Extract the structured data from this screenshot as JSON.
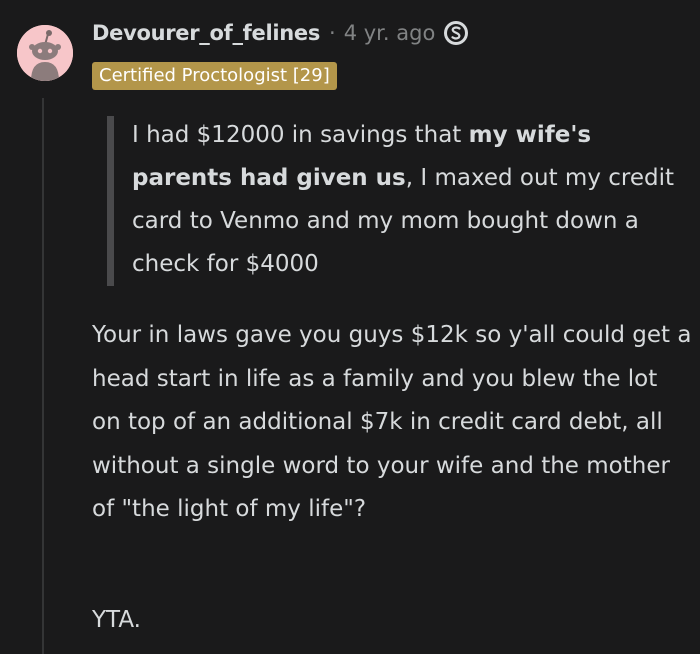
{
  "comment": {
    "author": "Devourer_of_felines",
    "separator": "·",
    "timestamp": "4 yr. ago",
    "flair": "Certified Proctologist [29]",
    "quote": {
      "part1": "I had $12000 in savings that ",
      "bold": "my wife's parents had given us",
      "part2": ", I maxed out my credit card to Venmo and my mom bought down a check for $4000"
    },
    "body": "Your in laws gave you guys $12k so y'all could get a head start in life as a family and you blew the lot on top of an additional $7k in credit card debt, all without a single word to your wife and the mother of \"the light of my life\"?",
    "verdict": "YTA."
  },
  "icons": {
    "avatar": "snoo-avatar",
    "award": "silver-award-icon"
  },
  "colors": {
    "background": "#1a1a1b",
    "text": "#d7dadc",
    "muted": "#818384",
    "flair_bg": "#b3964a",
    "avatar_bg": "#f7c6c9"
  }
}
